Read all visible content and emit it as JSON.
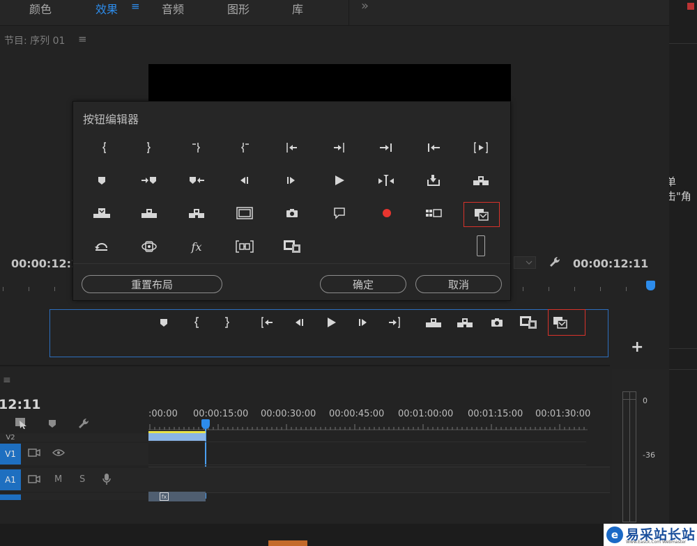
{
  "top_tabs": {
    "items": [
      {
        "label": "颜色"
      },
      {
        "label": "效果"
      },
      {
        "label": "音频"
      },
      {
        "label": "图形"
      },
      {
        "label": "库"
      }
    ],
    "menu_glyph": "≡",
    "overflow": "»"
  },
  "right_panel": {
    "partial_text": "单击\"角"
  },
  "program_monitor": {
    "title": "节目: 序列 01",
    "menu_glyph": "≡",
    "timecode_left": "00:00:12:1",
    "timecode_right": "00:00:12:11"
  },
  "button_editor": {
    "title": "按钮编辑器",
    "reset_label": "重置布局",
    "ok_label": "确定",
    "cancel_label": "取消",
    "icons": [
      "mark-in-icon",
      "mark-out-icon",
      "mark-clip-out-icon",
      "mark-clip-in-icon",
      "go-to-in-icon",
      "go-to-out-icon",
      "go-to-next-edit-icon",
      "go-to-previous-edit-icon",
      "play-in-to-out-icon",
      "add-marker-icon",
      "go-to-next-marker-icon",
      "go-to-previous-marker-icon",
      "step-back-icon",
      "step-forward-icon",
      "play-icon",
      "trim-monitor-icon",
      "export-frame-icon",
      "insert-icon",
      "overwrite-icon",
      "lift-icon",
      "extract-icon",
      "safe-margins-icon",
      "camera-icon",
      "comment-icon",
      "record-icon",
      "multi-camera-icon",
      "toggle-proxies-icon",
      "loop-icon",
      "vr-video-icon",
      "fx-icon",
      "comparison-view-icon",
      "filmstrip-icon",
      "placeholder-slot-icon"
    ]
  },
  "button_bar": {
    "icons": [
      "add-marker-icon",
      "mark-in-icon",
      "mark-out-icon",
      "go-to-in-icon",
      "step-back-icon",
      "play-icon",
      "step-forward-icon",
      "go-to-out-icon",
      "lift-icon",
      "extract-icon",
      "camera-icon",
      "filmstrip-icon",
      "toggle-proxies-icon"
    ],
    "add_glyph": "+"
  },
  "timeline": {
    "menu_glyph": "≡",
    "timecode": "12:11",
    "ruler_labels": [
      ":00:00",
      "00:00:15:00",
      "00:00:30:00",
      "00:00:45:00",
      "00:01:00:00",
      "00:01:15:00",
      "00:01:30:00"
    ],
    "tracks": [
      {
        "name": "V2"
      },
      {
        "name": "V1"
      },
      {
        "name": "A1",
        "m": "M",
        "s": "S"
      }
    ],
    "clip_fx": "fx"
  },
  "audio_meter": {
    "labels": [
      "0",
      "-36"
    ]
  },
  "watermark": {
    "logo_glyph": "e",
    "text": "易采站长站",
    "url": "Www.Easck.Com Webmaster"
  }
}
